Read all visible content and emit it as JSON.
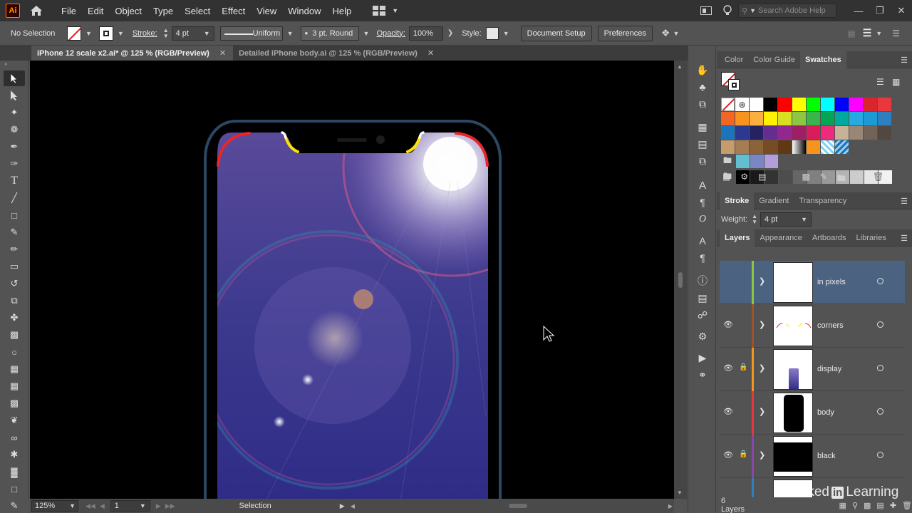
{
  "app": {
    "logo": "Ai",
    "menus": [
      "File",
      "Edit",
      "Object",
      "Type",
      "Select",
      "Effect",
      "View",
      "Window",
      "Help"
    ],
    "search_placeholder": "Search Adobe Help"
  },
  "controlbar": {
    "selection_label": "No Selection",
    "stroke_label": "Stroke:",
    "stroke_weight": "4 pt",
    "profile": "Uniform",
    "brush": "3 pt. Round",
    "opacity_label": "Opacity:",
    "opacity": "100%",
    "style_label": "Style:",
    "document_setup": "Document Setup",
    "preferences": "Preferences"
  },
  "tabs": [
    {
      "label": "iPhone 12 scale x2.ai* @ 125 % (RGB/Preview)",
      "active": true
    },
    {
      "label": "Detailed iPhone body.ai @ 125 % (RGB/Preview)",
      "active": false
    }
  ],
  "statusbar": {
    "zoom": "125%",
    "artboard": "1",
    "tool": "Selection"
  },
  "swatches_panel": {
    "tabs": [
      "Color",
      "Color Guide",
      "Swatches"
    ],
    "active_tab": "Swatches",
    "rows": [
      [
        "#ffffff",
        "#000000",
        "#ff0000",
        "#ffff00",
        "#00ff00",
        "#00ffff",
        "#0000ff",
        "#ff00ff",
        "#d9262e",
        "#e8383d"
      ],
      [
        "#f26522",
        "#f7941d",
        "#fbaf3f",
        "#fff200",
        "#d7df23",
        "#8dc63f",
        "#39b54a",
        "#00a651",
        "#00a99d",
        "#27aae1"
      ],
      [
        "#1c75bc",
        "#2b3990",
        "#262262",
        "#662d91",
        "#92278f",
        "#9e1f63",
        "#da1c5c",
        "#ee2a7b",
        "#c7b299",
        "#998675"
      ],
      [
        "#c69c6d",
        "#a67c52",
        "#8c6239",
        "#754c24",
        "#603813",
        "#f0f0f0",
        "#f7941d",
        "#7fd3f7",
        "#1b75bc"
      ],
      [
        "#62bfcf",
        "#7b87c4",
        "#b39ddb"
      ],
      [
        "#000000",
        "#1a1a1a",
        "#333333",
        "#4d4d4d",
        "#666666",
        "#808080",
        "#999999",
        "#b3b3b3",
        "#cccccc",
        "#e6e6e6",
        "#f2f2f2"
      ]
    ]
  },
  "stroke_panel": {
    "tabs": [
      "Stroke",
      "Gradient",
      "Transparency"
    ],
    "active_tab": "Stroke",
    "weight_label": "Weight:",
    "weight": "4 pt"
  },
  "layers_panel": {
    "tabs": [
      "Layers",
      "Appearance",
      "Artboards",
      "Libraries"
    ],
    "active_tab": "Layers",
    "layers": [
      {
        "name": "in pixels",
        "color": "#8dc63f",
        "visible": false,
        "locked": false,
        "selected": true
      },
      {
        "name": "corners",
        "color": "#a0522d",
        "visible": true,
        "locked": false,
        "selected": false
      },
      {
        "name": "display",
        "color": "#f7941d",
        "visible": true,
        "locked": true,
        "selected": false
      },
      {
        "name": "body",
        "color": "#e8383d",
        "visible": true,
        "locked": false,
        "selected": false
      },
      {
        "name": "black",
        "color": "#8e44ad",
        "visible": true,
        "locked": true,
        "selected": false
      }
    ],
    "count_label": "6 Layers"
  },
  "watermark": {
    "text": "Linked",
    "badge": "in",
    "suffix": "Learning"
  }
}
